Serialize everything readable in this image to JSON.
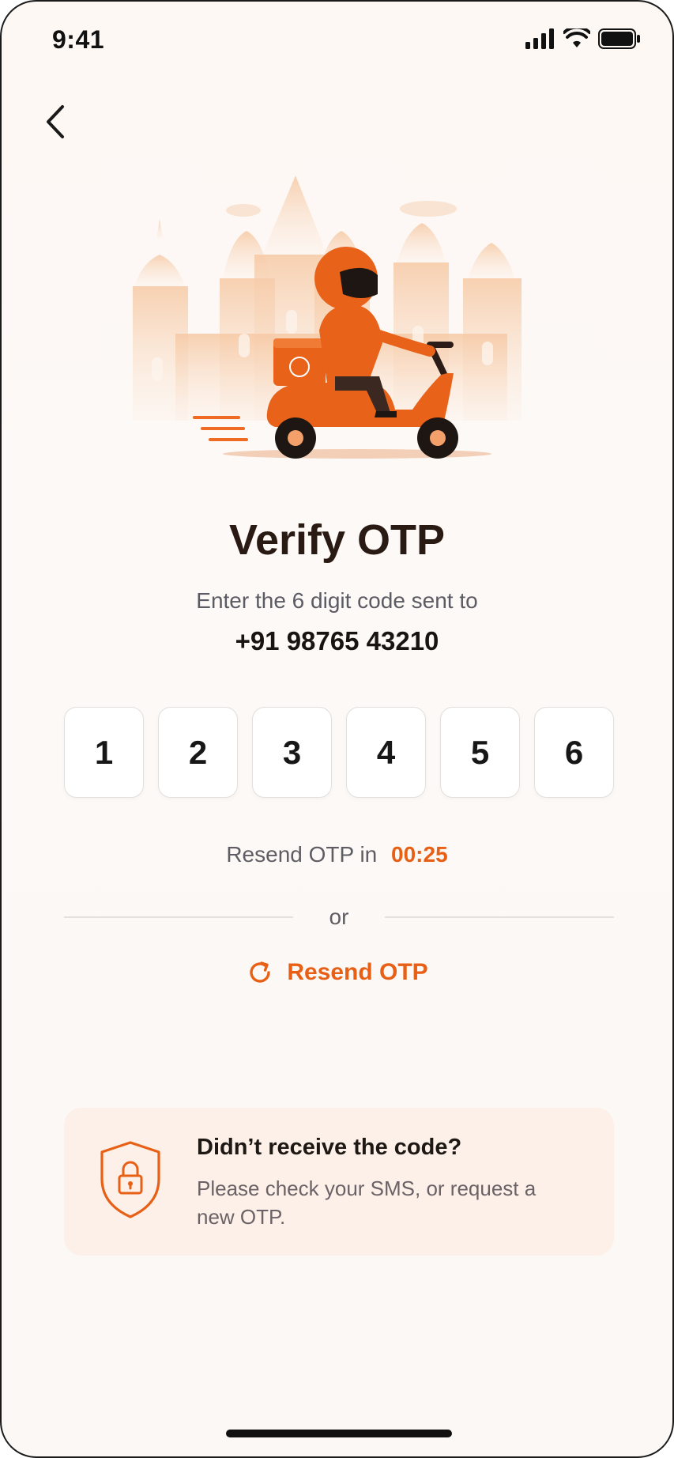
{
  "status_bar": {
    "time": "9:41",
    "icons": [
      "cellular-signal-icon",
      "wifi-icon",
      "battery-icon"
    ]
  },
  "navigation": {
    "back_icon": "chevron-left-icon"
  },
  "hero": {
    "illustration": "delivery-scooter-rider-with-palace-illustration",
    "accent_color": "#e8621a"
  },
  "header": {
    "title": "Verify OTP",
    "subtitle": "Enter the 6 digit code sent to",
    "phone_number": "+91 98765 43210"
  },
  "otp": {
    "digits": [
      "1",
      "2",
      "3",
      "4",
      "5",
      "6"
    ]
  },
  "resend": {
    "timer_label": "Resend OTP in",
    "timer_value": "00:25",
    "divider_text": "or",
    "button_label": "Resend OTP",
    "button_icon": "refresh-icon"
  },
  "help_card": {
    "icon": "shield-lock-icon",
    "title": "Didn’t receive the code?",
    "body": "Please check your SMS, or request a new OTP."
  },
  "colors": {
    "accent": "#e85f16",
    "background": "#fdf8f4",
    "card_background": "#fdf0e8"
  }
}
